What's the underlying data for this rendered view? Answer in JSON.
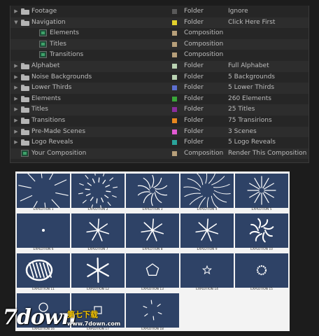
{
  "project": {
    "rows": [
      {
        "name": "Footage",
        "type": "Folder",
        "comment": "Ignore",
        "label_color": "#5a5a5a",
        "kind": "folder",
        "twirl": "right",
        "indent": 0
      },
      {
        "name": "Navigation",
        "type": "Folder",
        "comment": "Click Here First",
        "label_color": "#e3d12c",
        "kind": "folder",
        "twirl": "down",
        "indent": 0
      },
      {
        "name": "Elements",
        "type": "Composition",
        "comment": "",
        "label_color": "#b79f7a",
        "kind": "comp",
        "twirl": "none",
        "indent": 1
      },
      {
        "name": "Titles",
        "type": "Composition",
        "comment": "",
        "label_color": "#b79f7a",
        "kind": "comp",
        "twirl": "none",
        "indent": 1
      },
      {
        "name": "Transitions",
        "type": "Composition",
        "comment": "",
        "label_color": "#b79f7a",
        "kind": "comp",
        "twirl": "none",
        "indent": 1
      },
      {
        "name": "Alphabet",
        "type": "Folder",
        "comment": "Full Alphabet",
        "label_color": "#b9d2b2",
        "kind": "folder",
        "twirl": "right",
        "indent": 0
      },
      {
        "name": "Noise Backgrounds",
        "type": "Folder",
        "comment": "5 Backgrounds",
        "label_color": "#b9d2b2",
        "kind": "folder",
        "twirl": "right",
        "indent": 0
      },
      {
        "name": "Lower Thirds",
        "type": "Folder",
        "comment": "5 Lower Thirds",
        "label_color": "#5d6fcf",
        "kind": "folder",
        "twirl": "right",
        "indent": 0
      },
      {
        "name": "Elements",
        "type": "Folder",
        "comment": "260 Elements",
        "label_color": "#3aa63a",
        "kind": "folder",
        "twirl": "right",
        "indent": 0
      },
      {
        "name": "Titles",
        "type": "Folder",
        "comment": "25 Titles",
        "label_color": "#8a2e9c",
        "kind": "folder",
        "twirl": "right",
        "indent": 0
      },
      {
        "name": "Transitions",
        "type": "Folder",
        "comment": "75 Transirions",
        "label_color": "#e8871e",
        "kind": "folder",
        "twirl": "right",
        "indent": 0
      },
      {
        "name": "Pre-Made Scenes",
        "type": "Folder",
        "comment": "3 Scenes",
        "label_color": "#e25ad2",
        "kind": "folder",
        "twirl": "right",
        "indent": 0
      },
      {
        "name": "Logo Reveals",
        "type": "Folder",
        "comment": "5 Logo Reveals",
        "label_color": "#2aa39a",
        "kind": "folder",
        "twirl": "right",
        "indent": 0
      },
      {
        "name": "Your Composition",
        "type": "Composition",
        "comment": "Render This Composition",
        "label_color": "#b79f7a",
        "kind": "comp",
        "twirl": "none",
        "indent": 0
      }
    ]
  },
  "sheet": {
    "cells": [
      {
        "label": "EXPLOTION 1",
        "icon": "burst-lines-icon"
      },
      {
        "label": "EXPLOTION 2",
        "icon": "burst-dashes-icon"
      },
      {
        "label": "EXPLOTION 3",
        "icon": "swirl-burst-icon"
      },
      {
        "label": "EXPLOTION 4",
        "icon": "arc-burst-icon"
      },
      {
        "label": "EXPLOTION 5",
        "icon": "star-burst-icon"
      },
      {
        "label": "EXPLOTION 6",
        "icon": "dot-icon"
      },
      {
        "label": "EXPLOTION 7",
        "icon": "spark-burst-icon"
      },
      {
        "label": "EXPLOTION 8",
        "icon": "spark-burst-icon"
      },
      {
        "label": "EXPLOTION 9",
        "icon": "spark-burst-icon"
      },
      {
        "label": "EXPLOTION 10",
        "icon": "pinwheel-icon"
      },
      {
        "label": "EXPLOTION 11",
        "icon": "scribble-icon"
      },
      {
        "label": "EXPLOTION 12",
        "icon": "asterisk-icon"
      },
      {
        "label": "EXPLOTION 13",
        "icon": "pentagon-icon"
      },
      {
        "label": "EXPLOTION 14",
        "icon": "star-icon"
      },
      {
        "label": "EXPLOTION 15",
        "icon": "ring-icon"
      },
      {
        "label": "EXPLOTION 16",
        "icon": "circle-icon"
      },
      {
        "label": "EXPLOTION 17",
        "icon": "square-icon"
      },
      {
        "label": "EXPLOTION 18",
        "icon": "tick-burst-icon"
      }
    ]
  },
  "watermark": {
    "brand": "7down",
    "cn_text": "第七下载",
    "url": "www.7down.com"
  }
}
